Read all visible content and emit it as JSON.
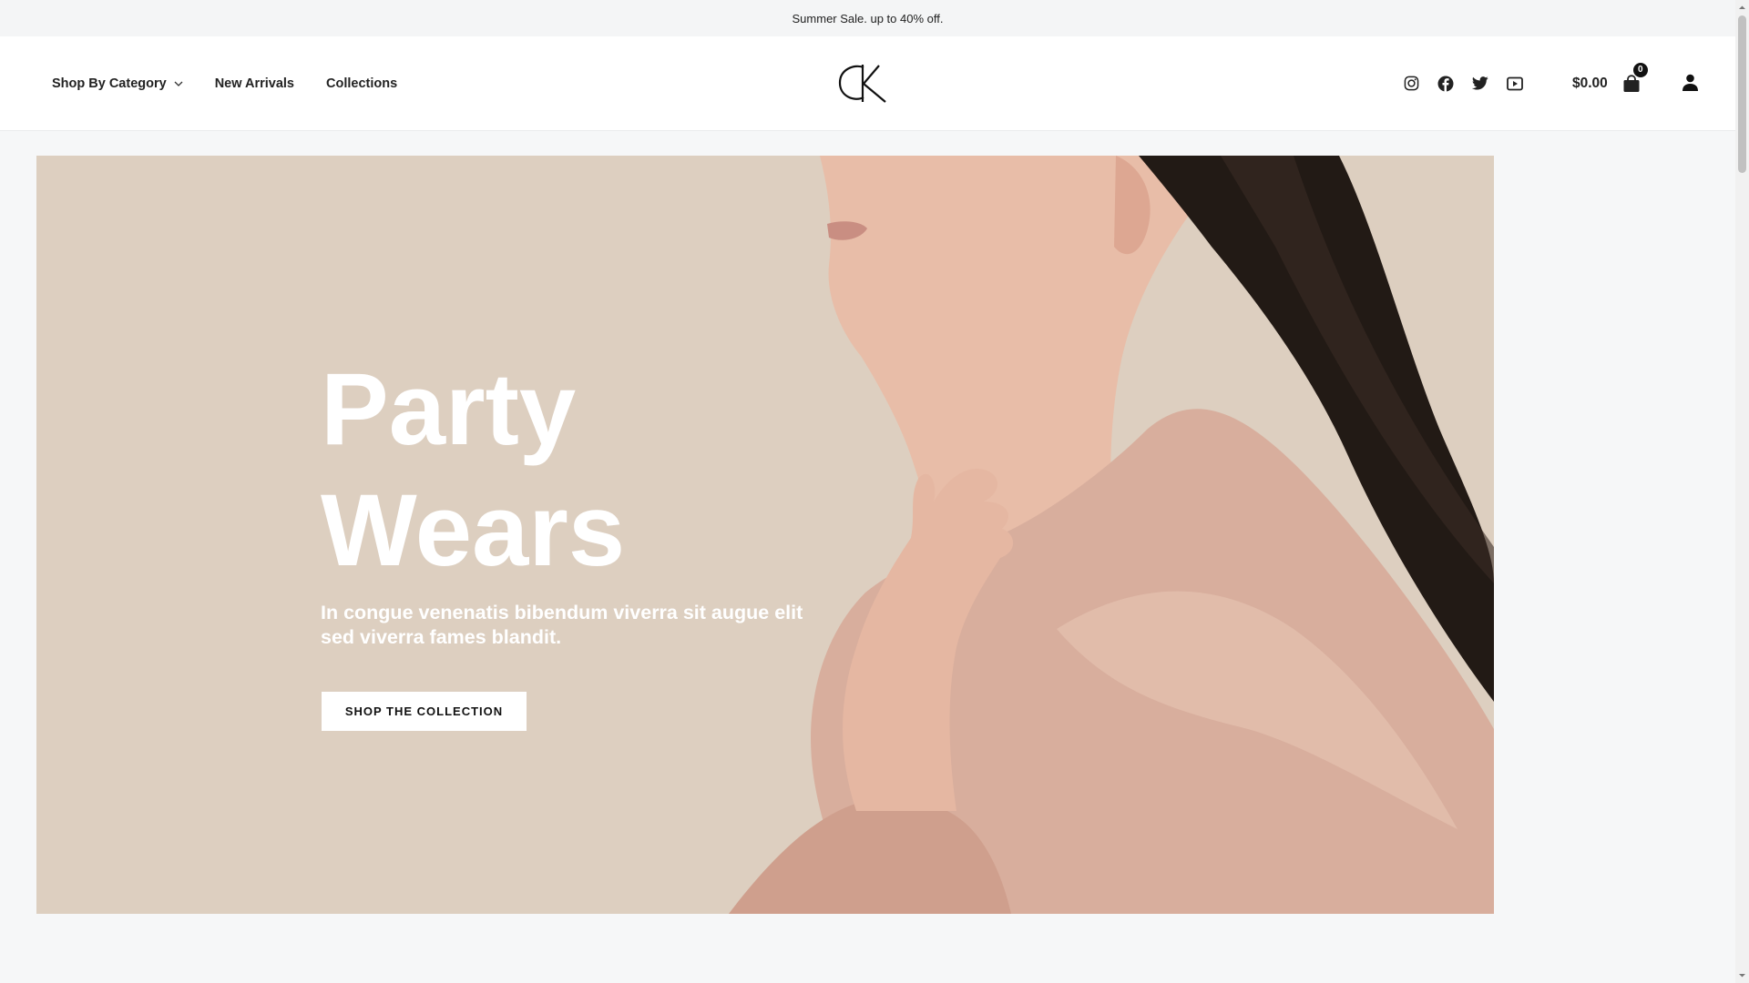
{
  "announcement": "Summer Sale. up to 40% off.",
  "nav": {
    "items": [
      {
        "label": "Shop By Category"
      },
      {
        "label": "New Arrivals"
      },
      {
        "label": "Collections"
      }
    ]
  },
  "logo": {
    "text": "CK"
  },
  "social": [
    "instagram-icon",
    "facebook-icon",
    "twitter-icon",
    "youtube-icon"
  ],
  "cart": {
    "total": "$0.00",
    "count": "0"
  },
  "hero": {
    "title_line1": "Party",
    "title_line2": "Wears",
    "subtitle": "In congue venenatis bibendum viverra sit augue elit sed viverra fames blandit.",
    "button": "SHOP THE COLLECTION"
  },
  "colors": {
    "hero_bg": "#ddcfc0",
    "blouse": "#d8ad9c",
    "skin": "#e6b9a4",
    "hair": "#1f1814",
    "text_dark": "#222222"
  }
}
